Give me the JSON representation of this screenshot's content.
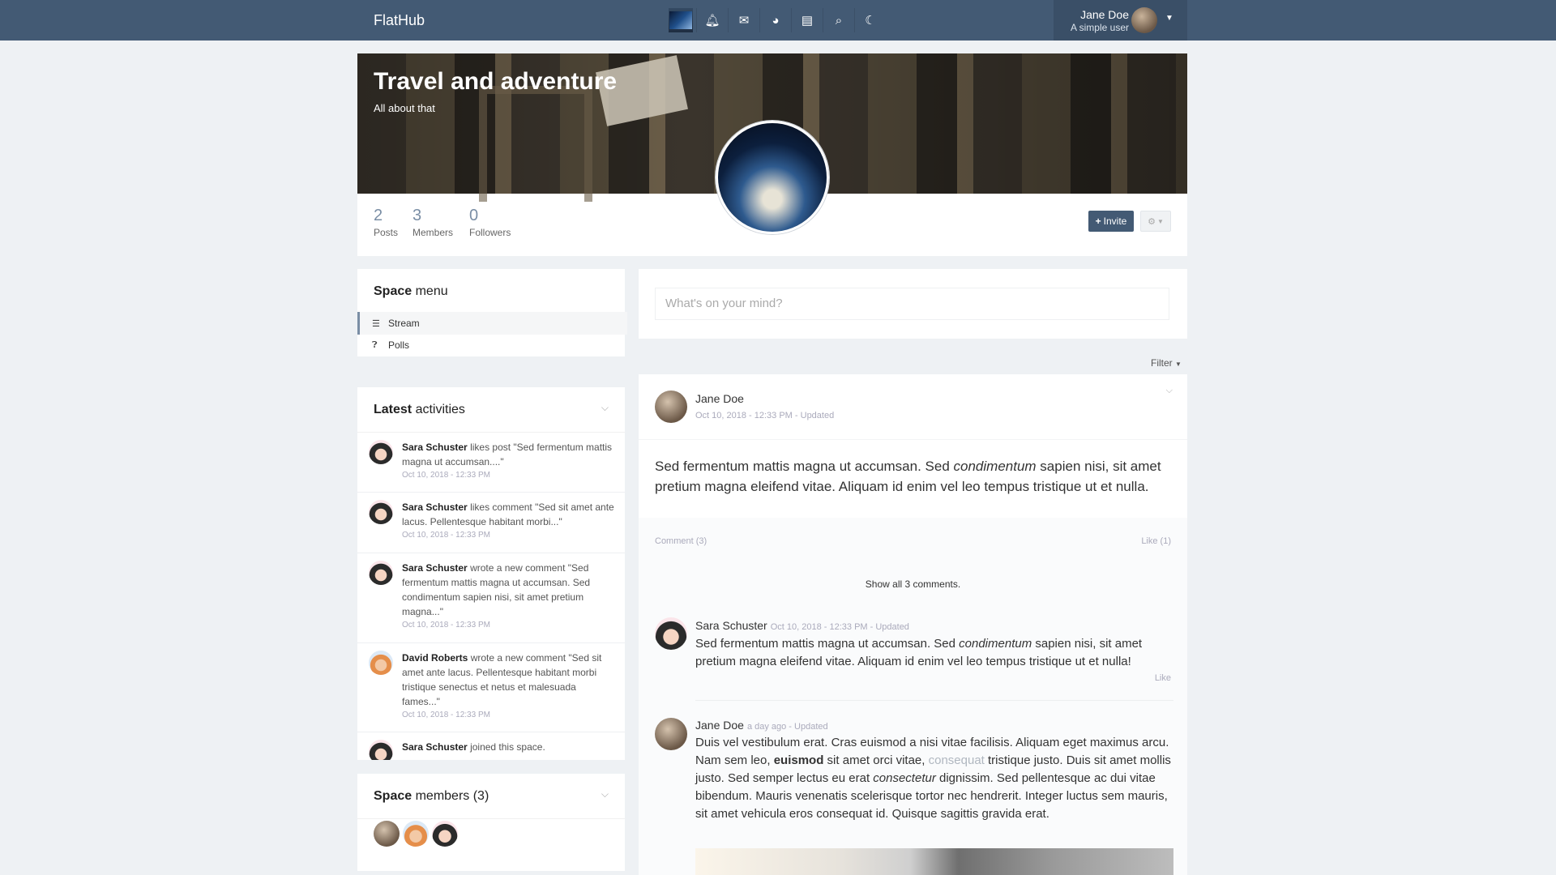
{
  "app": {
    "brand": "FlatHub"
  },
  "nav": {
    "icons": [
      "space-thumbnail",
      "bell-icon",
      "envelope-icon",
      "dashboard-icon",
      "book-icon",
      "search-icon",
      "moon-icon"
    ]
  },
  "user": {
    "name": "Jane Doe",
    "subtitle": "A simple user"
  },
  "space": {
    "title": "Travel and adventure",
    "subtitle": "All about that",
    "counters": [
      {
        "value": "2",
        "label": "Posts"
      },
      {
        "value": "3",
        "label": "Members"
      },
      {
        "value": "0",
        "label": "Followers"
      }
    ],
    "invite_label": "Invite"
  },
  "space_menu": {
    "title_bold": "Space",
    "title_rest": "menu",
    "items": [
      {
        "label": "Stream",
        "icon": "bars-icon"
      },
      {
        "label": "Polls",
        "icon": "question-circle-icon"
      }
    ]
  },
  "latest": {
    "title_bold": "Latest",
    "title_rest": "activities",
    "items": [
      {
        "user": "Sara Schuster",
        "text": "likes post \"Sed fermentum mattis magna ut accumsan....\"",
        "time": "Oct 10, 2018 - 12:33 PM",
        "avatar": "sara"
      },
      {
        "user": "Sara Schuster",
        "text": "likes comment \"Sed sit amet ante lacus. Pellentesque habitant morbi...\"",
        "time": "Oct 10, 2018 - 12:33 PM",
        "avatar": "sara"
      },
      {
        "user": "Sara Schuster",
        "text": "wrote a new comment \"Sed fermentum mattis magna ut accumsan. Sed condimentum sapien nisi, sit amet pretium magna...\"",
        "time": "Oct 10, 2018 - 12:33 PM",
        "avatar": "sara"
      },
      {
        "user": "David Roberts",
        "text": "wrote a new comment \"Sed sit amet ante lacus. Pellentesque habitant morbi tristique senectus et netus et malesuada fames...\"",
        "time": "Oct 10, 2018 - 12:33 PM",
        "avatar": "david"
      },
      {
        "user": "Sara Schuster",
        "text": "joined this space.",
        "time": "",
        "avatar": "sara"
      }
    ]
  },
  "members": {
    "title_bold": "Space",
    "title_rest": "members (3)"
  },
  "composer": {
    "placeholder": "What's on your mind?"
  },
  "filter_label": "Filter",
  "post": {
    "author": "Jane Doe",
    "meta": "Oct 10, 2018 - 12:33 PM - Updated",
    "text_a": "Sed fermentum mattis magna ut accumsan. Sed ",
    "text_em": "condimentum",
    "text_b": " sapien nisi, sit amet pretium magna eleifend vitae. Aliquam id enim vel leo tempus tristique ut et nulla.",
    "comment_link": "Comment (3)",
    "like_link": "Like (1)",
    "show_all": "Show all 3 comments."
  },
  "comments": [
    {
      "author": "Sara Schuster",
      "meta": "Oct 10, 2018 - 12:33 PM - Updated",
      "text_a": "Sed fermentum mattis magna ut accumsan. Sed ",
      "text_em": "condimentum",
      "text_b": " sapien nisi, sit amet pretium magna eleifend vitae. Aliquam id enim vel leo tempus tristique ut et nulla!",
      "like": "Like"
    },
    {
      "author": "Jane Doe",
      "meta": "a day ago - Updated",
      "text_a": "Duis vel vestibulum erat. Cras euismod a nisi vitae facilisis. Aliquam eget maximus arcu. Nam sem leo, ",
      "text_bold": "euismod",
      "text_b": " sit amet orci vitae, ",
      "text_link": "consequat",
      "text_c": " tristique justo. Duis sit amet mollis justo. Sed semper lectus eu erat ",
      "text_em": "consectetur",
      "text_d": " dignissim. Sed pellentesque ac dui vitae bibendum. Mauris venenatis scelerisque tortor nec hendrerit. Integer luctus sem mauris, sit amet vehicula eros consequat id. Quisque sagittis gravida erat."
    }
  ]
}
